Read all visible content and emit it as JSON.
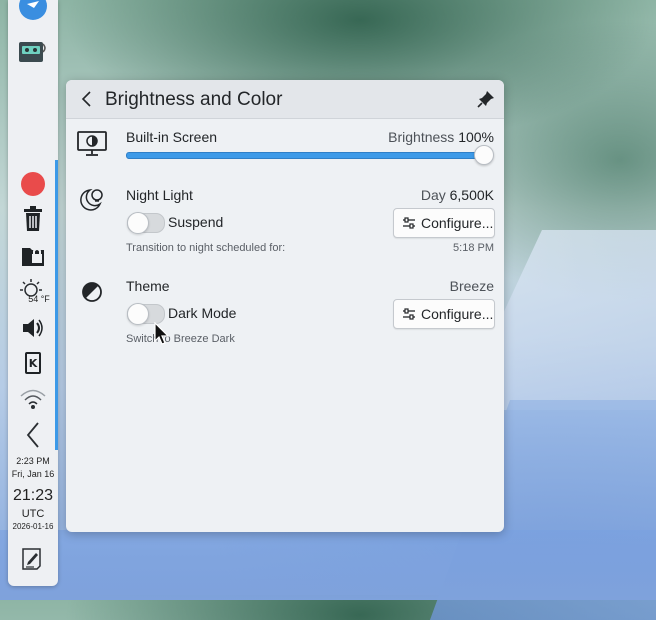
{
  "panel": {
    "clock_time": "2:23 PM",
    "clock_date": "Fri, Jan 16",
    "utc_time": "21:23",
    "utc_label": "UTC",
    "utc_date": "2026-01-16",
    "weather_temp": "54 °F"
  },
  "popup": {
    "title": "Brightness and Color",
    "screen": {
      "name": "Built-in Screen",
      "brightness_label": "Brightness",
      "brightness_value": "100%",
      "brightness_level": 1.0
    },
    "night_light": {
      "name": "Night Light",
      "mode": "Day",
      "temperature": "6,500K",
      "toggle_label": "Suspend",
      "toggle_on": false,
      "configure_label": "Configure...",
      "transition_text": "Transition to night scheduled for:",
      "transition_time": "5:18 PM"
    },
    "theme": {
      "name": "Theme",
      "current": "Breeze",
      "toggle_label": "Dark Mode",
      "toggle_on": false,
      "configure_label": "Configure...",
      "hint": "Switch to Breeze Dark"
    }
  },
  "colors": {
    "accent": "#3d9ae8",
    "record": "#e94b4b"
  }
}
